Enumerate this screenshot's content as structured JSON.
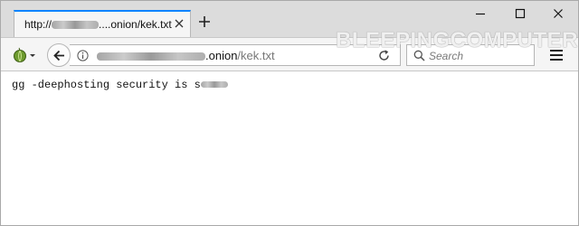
{
  "tab": {
    "title_prefix": "http://",
    "title_suffix": "....onion/kek.txt"
  },
  "address_bar": {
    "host_suffix": ".onion",
    "path": "/kek.txt"
  },
  "search": {
    "placeholder": "Search"
  },
  "watermark": {
    "text": "BLEEPINGCOMPUTER"
  },
  "document": {
    "text": "gg -deephosting security is s"
  },
  "icons": {
    "tab_close": "close-icon",
    "new_tab": "plus-icon",
    "minimize": "minimize-icon",
    "maximize": "maximize-icon",
    "window_close": "close-icon",
    "identity": "tor-onion-icon",
    "back": "back-arrow-icon",
    "site_info": "info-icon",
    "reload": "reload-icon",
    "search": "search-icon",
    "menu": "hamburger-menu-icon"
  },
  "colors": {
    "tab_accent": "#0a84ff",
    "chrome_bg": "#dcdcdc",
    "toolbar_bg": "#f5f5f5"
  }
}
